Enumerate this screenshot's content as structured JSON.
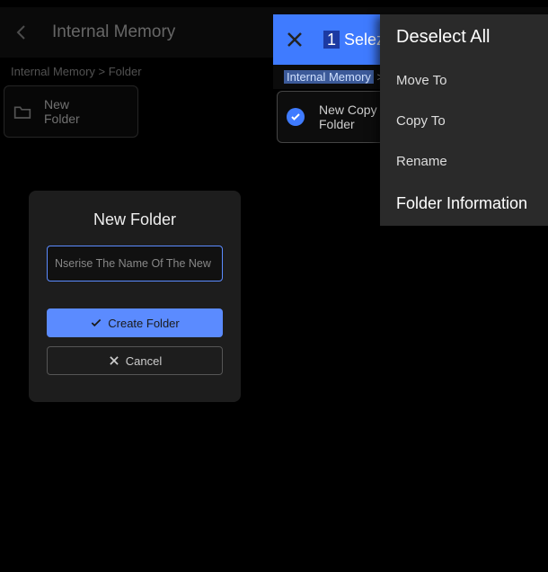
{
  "topbar": {
    "title": "Internal Memory"
  },
  "breadcrumb": "Internal Memory > Folder",
  "folder_card": {
    "line1": "New",
    "line2": "Folder"
  },
  "dialog": {
    "title": "New Folder",
    "placeholder": "Nserise The Name Of The New (",
    "create": "Create Folder",
    "cancel": "Cancel"
  },
  "selection": {
    "count": "1",
    "sel_word": "Selezic",
    "deselect": "Deselect All",
    "breadcrumb_hl": "Internal Memory",
    "breadcrumb_sep": ">",
    "folder_line1": "New",
    "folder_line2": "Folder",
    "overlay_action": "Copy To"
  },
  "menu": {
    "deselect": "Deselect All",
    "move": "Move To",
    "copy": "Copy To",
    "rename": "Rename",
    "info": "Folder Information"
  }
}
